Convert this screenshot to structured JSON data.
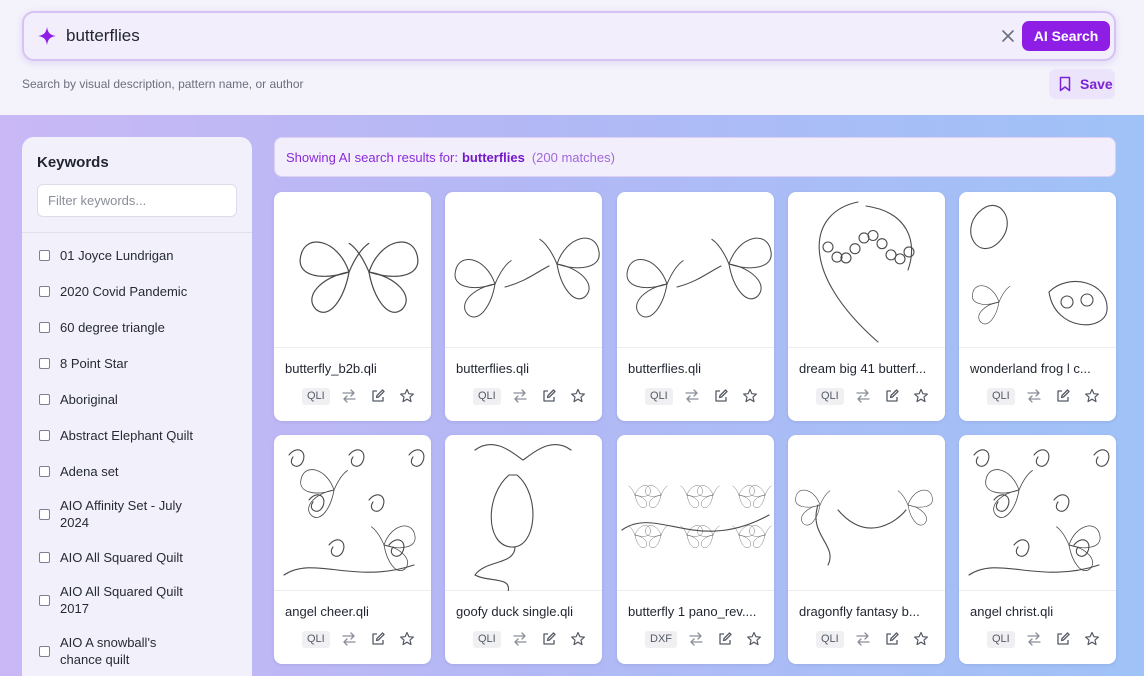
{
  "search": {
    "value": "butterflies",
    "ai_button_label": "AI Search",
    "hint": "Search by visual description, pattern name, or author",
    "save_label": "Save"
  },
  "sidebar": {
    "title": "Keywords",
    "filter_placeholder": "Filter keywords...",
    "items": [
      {
        "label": "01 Joyce Lundrigan"
      },
      {
        "label": "2020 Covid Pandemic"
      },
      {
        "label": "60 degree triangle"
      },
      {
        "label": "8 Point Star"
      },
      {
        "label": "Aboriginal"
      },
      {
        "label": "Abstract Elephant Quilt"
      },
      {
        "label": "Adena set"
      },
      {
        "label": "AIO Affinity Set - July 2024"
      },
      {
        "label": "AIO All Squared Quilt"
      },
      {
        "label": "AIO All Squared Quilt 2017"
      },
      {
        "label": "AIO A snowball's chance quilt"
      }
    ]
  },
  "results": {
    "prefix": "Showing AI search results for:",
    "query": "butterflies",
    "count": "(200 matches)",
    "cards": [
      {
        "name": "butterfly_b2b.qli",
        "format": "QLI"
      },
      {
        "name": "butterflies.qli",
        "format": "QLI"
      },
      {
        "name": "butterflies.qli",
        "format": "QLI"
      },
      {
        "name": "dream big 41 butterf...",
        "format": "QLI"
      },
      {
        "name": "wonderland frog l c...",
        "format": "QLI"
      },
      {
        "name": "angel cheer.qli",
        "format": "QLI"
      },
      {
        "name": "goofy duck single.qli",
        "format": "QLI"
      },
      {
        "name": "butterfly 1 pano_rev....",
        "format": "DXF"
      },
      {
        "name": "dragonfly fantasy b...",
        "format": "QLI"
      },
      {
        "name": "angel christ.qli",
        "format": "QLI"
      }
    ]
  },
  "colors": {
    "accent": "#8e1ee6",
    "accent_text": "#7319c9",
    "search_border": "#d6c3f3"
  }
}
